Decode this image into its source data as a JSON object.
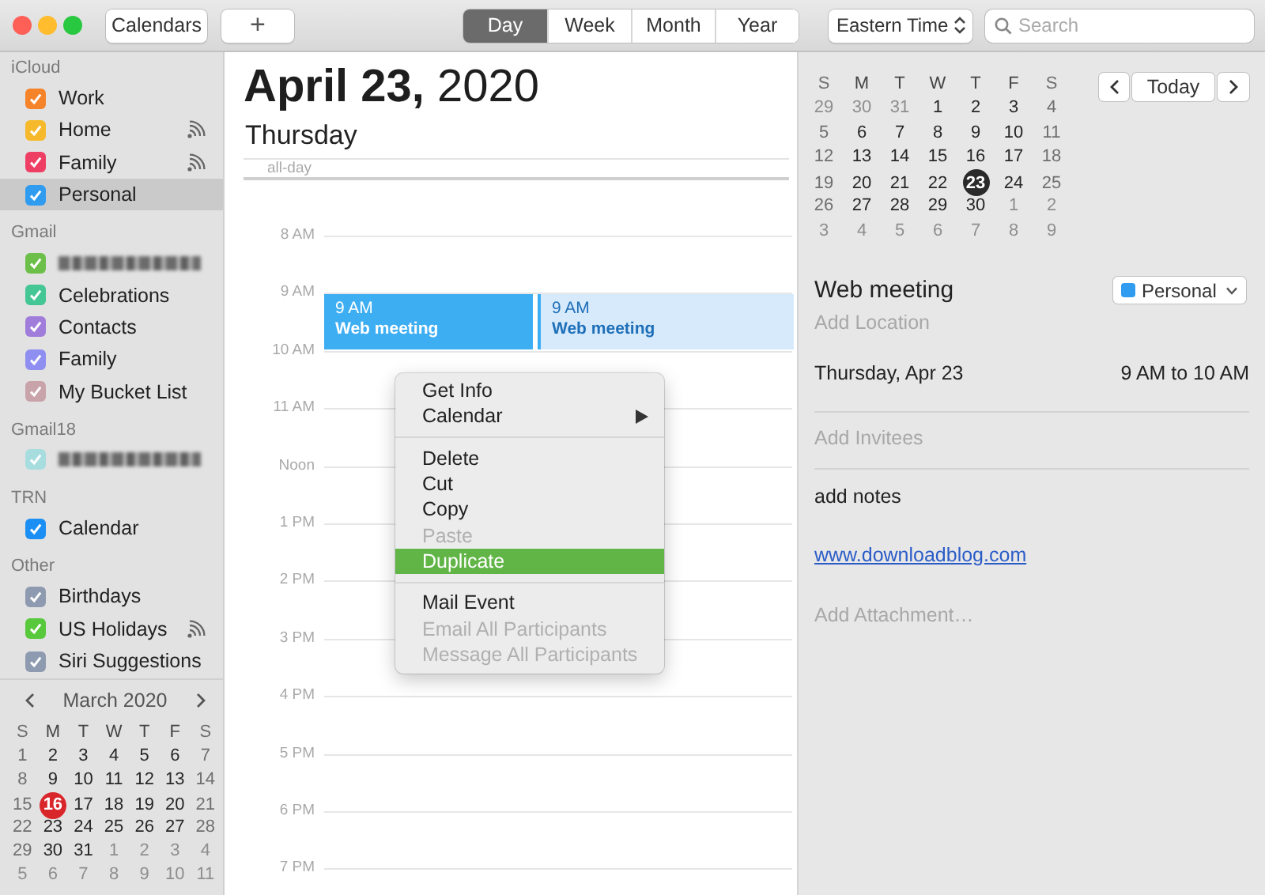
{
  "toolbar": {
    "calendars_button": "Calendars",
    "add_button": "+",
    "views": [
      {
        "label": "Day",
        "selected": true
      },
      {
        "label": "Week",
        "selected": false
      },
      {
        "label": "Month",
        "selected": false
      },
      {
        "label": "Year",
        "selected": false
      }
    ],
    "timezone": "Eastern Time",
    "search": {
      "placeholder": "Search"
    }
  },
  "sidebar": {
    "groups": [
      {
        "title": "iCloud",
        "items": [
          {
            "kind": "calendar",
            "label": "Work",
            "color": "#f5832a",
            "checked": true,
            "shared": false,
            "selected": false
          },
          {
            "kind": "calendar",
            "label": "Home",
            "color": "#f6b92b",
            "checked": true,
            "shared": true,
            "selected": false
          },
          {
            "kind": "calendar",
            "label": "Family",
            "color": "#ee3e64",
            "checked": true,
            "shared": true,
            "selected": false
          },
          {
            "kind": "calendar",
            "label": "Personal",
            "color": "#2f9cf0",
            "checked": true,
            "shared": false,
            "selected": true
          }
        ]
      },
      {
        "title": "Gmail",
        "items": [
          {
            "kind": "redacted",
            "color": "#6cc04a",
            "checked": true,
            "shared": false,
            "selected": false
          },
          {
            "kind": "calendar",
            "label": "Celebrations",
            "color": "#44c695",
            "checked": true,
            "shared": false,
            "selected": false
          },
          {
            "kind": "calendar",
            "label": "Contacts",
            "color": "#a17ddb",
            "checked": true,
            "shared": false,
            "selected": false
          },
          {
            "kind": "calendar",
            "label": "Family",
            "color": "#8e8ff0",
            "checked": true,
            "shared": false,
            "selected": false
          },
          {
            "kind": "calendar",
            "label": "My Bucket List",
            "color": "#c9a3aa",
            "checked": true,
            "shared": false,
            "selected": false
          }
        ]
      },
      {
        "title": "Gmail18",
        "items": [
          {
            "kind": "redacted",
            "color": "#a8dde0",
            "checked": true,
            "shared": false,
            "selected": false
          }
        ]
      },
      {
        "title": "TRN",
        "items": [
          {
            "kind": "calendar",
            "label": "Calendar",
            "color": "#1c8ff5",
            "checked": true,
            "shared": false,
            "selected": false
          }
        ]
      },
      {
        "title": "Other",
        "items": [
          {
            "kind": "calendar",
            "label": "Birthdays",
            "color": "#8d9ab0",
            "checked": true,
            "shared": false,
            "selected": false
          },
          {
            "kind": "calendar",
            "label": "US Holidays",
            "color": "#58c83c",
            "checked": true,
            "shared": true,
            "selected": false
          },
          {
            "kind": "calendar",
            "label": "Siri Suggestions",
            "color": "#8d9ab0",
            "checked": true,
            "shared": false,
            "selected": false
          }
        ]
      }
    ],
    "mini_calendar": {
      "title": "March 2020",
      "weekdays": [
        "S",
        "M",
        "T",
        "W",
        "T",
        "F",
        "S"
      ],
      "weeks": [
        [
          {
            "d": "1",
            "muted": false,
            "today": false
          },
          {
            "d": "2",
            "muted": false,
            "today": false
          },
          {
            "d": "3",
            "muted": false,
            "today": false
          },
          {
            "d": "4",
            "muted": false,
            "today": false
          },
          {
            "d": "5",
            "muted": false,
            "today": false
          },
          {
            "d": "6",
            "muted": false,
            "today": false
          },
          {
            "d": "7",
            "muted": false,
            "today": false
          }
        ],
        [
          {
            "d": "8",
            "muted": false,
            "today": false
          },
          {
            "d": "9",
            "muted": false,
            "today": false
          },
          {
            "d": "10",
            "muted": false,
            "today": false
          },
          {
            "d": "11",
            "muted": false,
            "today": false
          },
          {
            "d": "12",
            "muted": false,
            "today": false
          },
          {
            "d": "13",
            "muted": false,
            "today": false
          },
          {
            "d": "14",
            "muted": false,
            "today": false
          }
        ],
        [
          {
            "d": "15",
            "muted": false,
            "today": false
          },
          {
            "d": "16",
            "muted": false,
            "today": true
          },
          {
            "d": "17",
            "muted": false,
            "today": false
          },
          {
            "d": "18",
            "muted": false,
            "today": false
          },
          {
            "d": "19",
            "muted": false,
            "today": false
          },
          {
            "d": "20",
            "muted": false,
            "today": false
          },
          {
            "d": "21",
            "muted": false,
            "today": false
          }
        ],
        [
          {
            "d": "22",
            "muted": false,
            "today": false
          },
          {
            "d": "23",
            "muted": false,
            "today": false
          },
          {
            "d": "24",
            "muted": false,
            "today": false
          },
          {
            "d": "25",
            "muted": false,
            "today": false
          },
          {
            "d": "26",
            "muted": false,
            "today": false
          },
          {
            "d": "27",
            "muted": false,
            "today": false
          },
          {
            "d": "28",
            "muted": false,
            "today": false
          }
        ],
        [
          {
            "d": "29",
            "muted": false,
            "today": false
          },
          {
            "d": "30",
            "muted": false,
            "today": false
          },
          {
            "d": "31",
            "muted": false,
            "today": false
          },
          {
            "d": "1",
            "muted": true,
            "today": false
          },
          {
            "d": "2",
            "muted": true,
            "today": false
          },
          {
            "d": "3",
            "muted": true,
            "today": false
          },
          {
            "d": "4",
            "muted": true,
            "today": false
          }
        ],
        [
          {
            "d": "5",
            "muted": true,
            "today": false
          },
          {
            "d": "6",
            "muted": true,
            "today": false
          },
          {
            "d": "7",
            "muted": true,
            "today": false
          },
          {
            "d": "8",
            "muted": true,
            "today": false
          },
          {
            "d": "9",
            "muted": true,
            "today": false
          },
          {
            "d": "10",
            "muted": true,
            "today": false
          },
          {
            "d": "11",
            "muted": true,
            "today": false
          }
        ]
      ]
    }
  },
  "day_view": {
    "title": "**April 23,** 2020",
    "weekday": "Thursday",
    "all_day_label": "all-day",
    "hours": [
      "8 AM",
      "9 AM",
      "10 AM",
      "11 AM",
      "Noon",
      "1 PM",
      "2 PM",
      "3 PM",
      "4 PM",
      "5 PM",
      "6 PM",
      "7 PM"
    ],
    "events": [
      {
        "time": "9 AM",
        "title": "Web meeting",
        "selected": true
      },
      {
        "time": "9 AM",
        "title": "Web meeting",
        "selected": false
      }
    ],
    "context_menu": {
      "groups": [
        [
          {
            "label": "Get Info",
            "disabled": false,
            "selected": false,
            "submenu": false
          },
          {
            "label": "Calendar",
            "disabled": false,
            "selected": false,
            "submenu": true
          }
        ],
        [
          {
            "label": "Delete",
            "disabled": false,
            "selected": false,
            "submenu": false
          },
          {
            "label": "Cut",
            "disabled": false,
            "selected": false,
            "submenu": false
          },
          {
            "label": "Copy",
            "disabled": false,
            "selected": false,
            "submenu": false
          },
          {
            "label": "Paste",
            "disabled": true,
            "selected": false,
            "submenu": false
          },
          {
            "label": "Duplicate",
            "disabled": false,
            "selected": true,
            "submenu": false
          }
        ],
        [
          {
            "label": "Mail Event",
            "disabled": false,
            "selected": false,
            "submenu": false
          },
          {
            "label": "Email All Participants",
            "disabled": true,
            "selected": false,
            "submenu": false
          },
          {
            "label": "Message All Participants",
            "disabled": true,
            "selected": false,
            "submenu": false
          }
        ]
      ]
    }
  },
  "inspector": {
    "mini_calendar": {
      "weekdays": [
        "S",
        "M",
        "T",
        "W",
        "T",
        "F",
        "S"
      ],
      "weeks": [
        [
          {
            "d": "29",
            "muted": true,
            "selected": false
          },
          {
            "d": "30",
            "muted": true,
            "selected": false
          },
          {
            "d": "31",
            "muted": true,
            "selected": false
          },
          {
            "d": "1",
            "muted": false,
            "selected": false
          },
          {
            "d": "2",
            "muted": false,
            "selected": false
          },
          {
            "d": "3",
            "muted": false,
            "selected": false
          },
          {
            "d": "4",
            "muted": false,
            "selected": false
          }
        ],
        [
          {
            "d": "5",
            "muted": false,
            "selected": false
          },
          {
            "d": "6",
            "muted": false,
            "selected": false
          },
          {
            "d": "7",
            "muted": false,
            "selected": false
          },
          {
            "d": "8",
            "muted": false,
            "selected": false
          },
          {
            "d": "9",
            "muted": false,
            "selected": false
          },
          {
            "d": "10",
            "muted": false,
            "selected": false
          },
          {
            "d": "11",
            "muted": false,
            "selected": false
          }
        ],
        [
          {
            "d": "12",
            "muted": false,
            "selected": false
          },
          {
            "d": "13",
            "muted": false,
            "selected": false
          },
          {
            "d": "14",
            "muted": false,
            "selected": false
          },
          {
            "d": "15",
            "muted": false,
            "selected": false
          },
          {
            "d": "16",
            "muted": false,
            "selected": false
          },
          {
            "d": "17",
            "muted": false,
            "selected": false
          },
          {
            "d": "18",
            "muted": false,
            "selected": false
          }
        ],
        [
          {
            "d": "19",
            "muted": false,
            "selected": false
          },
          {
            "d": "20",
            "muted": false,
            "selected": false
          },
          {
            "d": "21",
            "muted": false,
            "selected": false
          },
          {
            "d": "22",
            "muted": false,
            "selected": false
          },
          {
            "d": "23",
            "muted": false,
            "selected": true
          },
          {
            "d": "24",
            "muted": false,
            "selected": false
          },
          {
            "d": "25",
            "muted": false,
            "selected": false
          }
        ],
        [
          {
            "d": "26",
            "muted": false,
            "selected": false
          },
          {
            "d": "27",
            "muted": false,
            "selected": false
          },
          {
            "d": "28",
            "muted": false,
            "selected": false
          },
          {
            "d": "29",
            "muted": false,
            "selected": false
          },
          {
            "d": "30",
            "muted": false,
            "selected": false
          },
          {
            "d": "1",
            "muted": true,
            "selected": false
          },
          {
            "d": "2",
            "muted": true,
            "selected": false
          }
        ],
        [
          {
            "d": "3",
            "muted": true,
            "selected": false
          },
          {
            "d": "4",
            "muted": true,
            "selected": false
          },
          {
            "d": "5",
            "muted": true,
            "selected": false
          },
          {
            "d": "6",
            "muted": true,
            "selected": false
          },
          {
            "d": "7",
            "muted": true,
            "selected": false
          },
          {
            "d": "8",
            "muted": true,
            "selected": false
          },
          {
            "d": "9",
            "muted": true,
            "selected": false
          }
        ]
      ]
    },
    "today_button": "Today",
    "event": {
      "title": "Web meeting",
      "calendar": {
        "label": "Personal",
        "color": "#2f9cf0"
      },
      "location": {
        "placeholder": "Add Location"
      },
      "date": "Thursday, Apr 23",
      "time_range": "9 AM to 10 AM",
      "invitees": {
        "placeholder": "Add Invitees"
      },
      "notes": "add notes",
      "url": "www.downloadblog.com",
      "attachment": {
        "placeholder": "Add Attachment…"
      }
    }
  }
}
